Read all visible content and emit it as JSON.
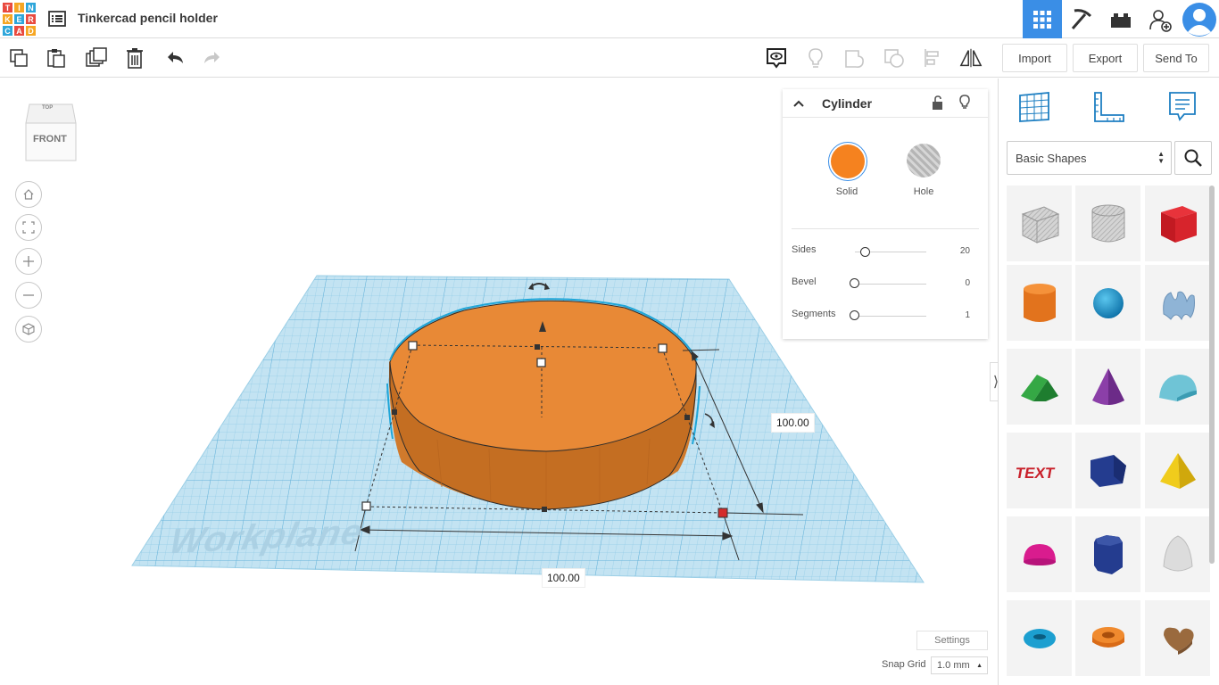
{
  "app": {
    "logo_letters": [
      "T",
      "I",
      "N",
      "K",
      "E",
      "R",
      "C",
      "A",
      "D"
    ],
    "logo_colors": [
      "#e94a3f",
      "#f6a623",
      "#2ea6da",
      "#f6a623",
      "#2ea6da",
      "#e94a3f",
      "#2ea6da",
      "#e94a3f",
      "#f6a623"
    ],
    "design_title": "Tinkercad pencil holder",
    "accent": "#3a8ee6"
  },
  "header": {
    "right_icons": [
      "grid-view-icon",
      "pickaxe-icon",
      "bricks-icon",
      "add-user-icon",
      "avatar"
    ]
  },
  "toolbar": {
    "left_icons": [
      "copy-icon",
      "paste-icon",
      "duplicate-icon",
      "delete-icon",
      "undo-icon",
      "redo-icon"
    ],
    "right_icons": [
      "note-icon",
      "light-bulb-icon",
      "group-icon",
      "ungroup-icon",
      "align-icon",
      "mirror-icon"
    ],
    "import_label": "Import",
    "export_label": "Export",
    "sendto_label": "Send To"
  },
  "viewcube": {
    "top_label": "TOP",
    "front_label": "FRONT"
  },
  "nav_controls": [
    "home-view-icon",
    "fit-view-icon",
    "zoom-in-icon",
    "zoom-out-icon",
    "perspective-icon"
  ],
  "workplane": {
    "label": "Workplane",
    "width_dim": "100.00",
    "depth_dim": "100.00"
  },
  "inspector": {
    "title": "Cylinder",
    "solid_label": "Solid",
    "hole_label": "Hole",
    "solid_color": "#f5821f",
    "props": [
      {
        "label": "Sides",
        "value": "20",
        "level": 0.05
      },
      {
        "label": "Bevel",
        "value": "0",
        "level": 0.0
      },
      {
        "label": "Segments",
        "value": "1",
        "level": 0.0
      }
    ]
  },
  "bottom": {
    "settings_label": "Settings",
    "snap_label": "Snap Grid",
    "snap_value": "1.0 mm"
  },
  "right_panel": {
    "tabs": [
      "workplane-grid-icon",
      "ruler-icon",
      "notes-icon"
    ],
    "category": "Basic Shapes",
    "shapes": [
      "box-hole-shape",
      "cylinder-hole-shape",
      "box-shape",
      "cylinder-shape",
      "sphere-shape",
      "scribble-shape",
      "roof-shape",
      "cone-shape",
      "round-roof-shape",
      "text-shape",
      "polygon-prism-shape",
      "pyramid-shape",
      "half-sphere-shape",
      "hexagonal-prism-shape",
      "paraboloid-shape",
      "torus-shape",
      "tube-shape",
      "heart-shape"
    ]
  }
}
